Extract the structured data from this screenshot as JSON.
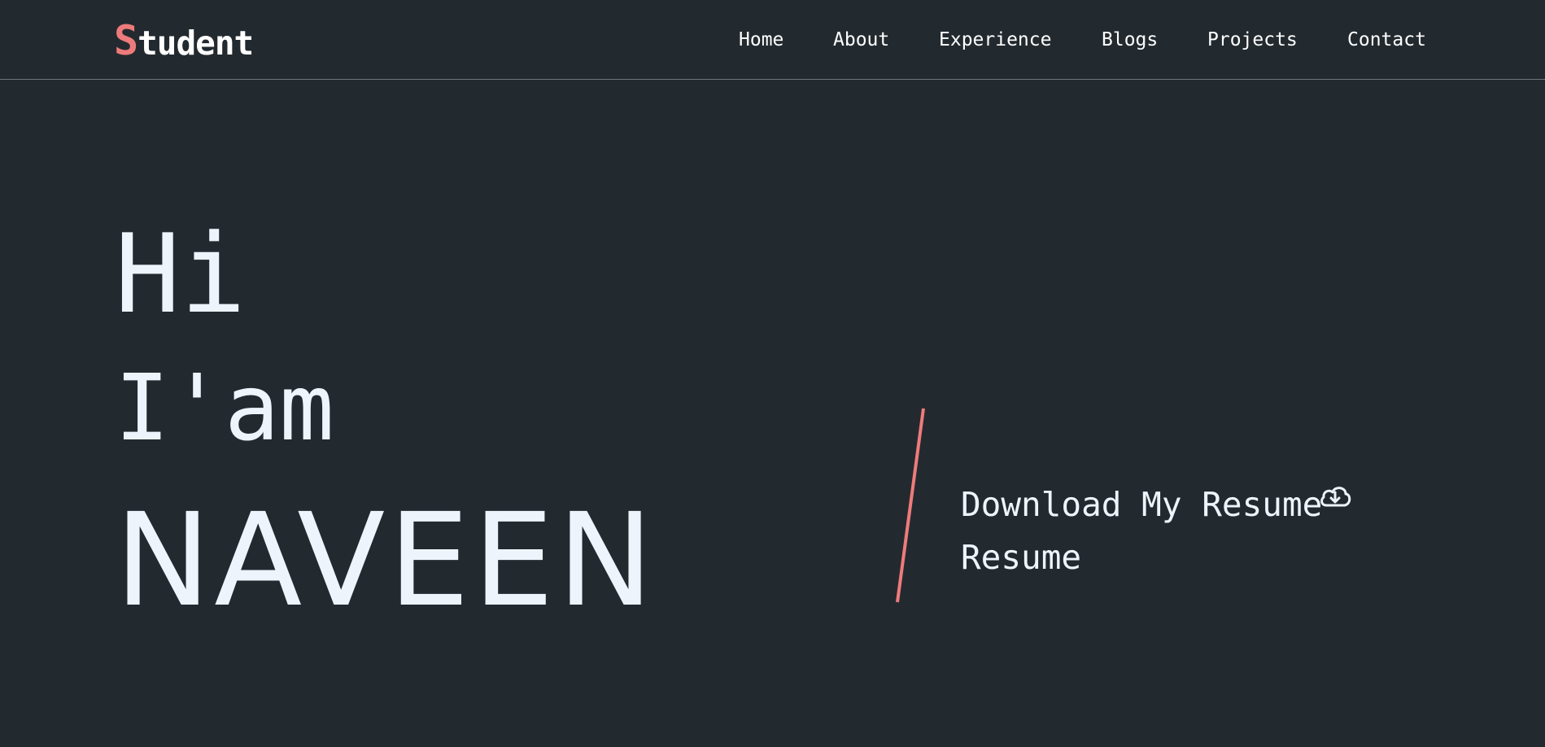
{
  "colors": {
    "background": "#232a2f",
    "text": "#eef4fb",
    "accent": "#ee7b7b",
    "nav_border": "#6e767c"
  },
  "header": {
    "logo_initial": "S",
    "logo_rest": "tudent",
    "nav": [
      {
        "label": "Home"
      },
      {
        "label": "About"
      },
      {
        "label": "Experience"
      },
      {
        "label": "Blogs"
      },
      {
        "label": "Projects"
      },
      {
        "label": "Contact"
      }
    ]
  },
  "hero": {
    "line1": "Hi",
    "line2": "I'am",
    "name": "NAVEEN",
    "resume_link": "Download My Resume",
    "resume_icon": "cloud-download-icon",
    "resume_second_line": "Resume"
  }
}
